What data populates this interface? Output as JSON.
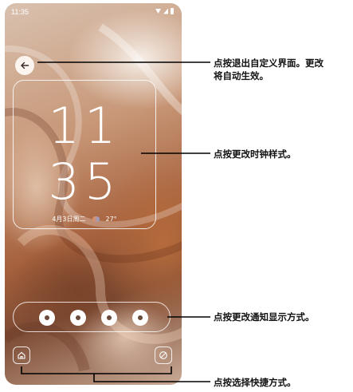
{
  "status_bar": {
    "time": "11:35"
  },
  "clock": {
    "hour": "11",
    "minute": "35",
    "date": "4月3日周二",
    "temperature": "27°"
  },
  "callouts": {
    "back": "点按退出自定义界面。更改将自动生效。",
    "back_line1": "点按退出自定义界面。更改",
    "back_line2": "将自动生效。",
    "clock_style": "点按更改时钟样式。",
    "notification_style": "点按更改通知显示方式。",
    "shortcuts": "点按选择快捷方式。"
  },
  "icons": {
    "back": "arrow-left-icon",
    "home_shortcut": "home-icon",
    "disabled_shortcut": "no-entry-icon",
    "wifi": "wifi-icon",
    "signal": "signal-icon",
    "battery": "battery-icon"
  },
  "colors": {
    "accent": "#000000",
    "wallpaper_primary": "#b36c3c",
    "wallpaper_light": "#f4ece4"
  }
}
